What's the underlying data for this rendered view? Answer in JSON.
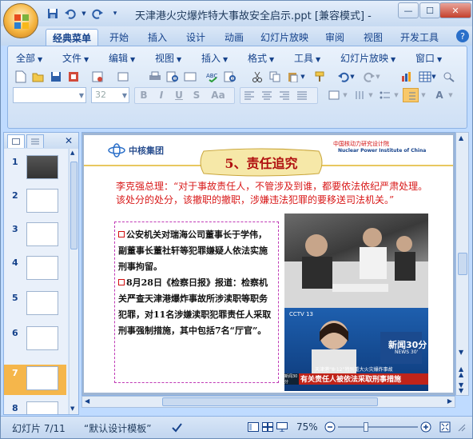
{
  "window": {
    "title": "天津港火灾爆炸特大事故安全启示.ppt [兼容模式] - M..."
  },
  "tabs": [
    "经典菜单",
    "开始",
    "插入",
    "设计",
    "动画",
    "幻灯片放映",
    "审阅",
    "视图",
    "开发工具"
  ],
  "menus": [
    "全部",
    "文件",
    "编辑",
    "视图",
    "插入",
    "格式",
    "工具",
    "幻灯片放映",
    "窗口"
  ],
  "font": {
    "name": "",
    "size": "32"
  },
  "slides_panel": {
    "numbers": [
      "1",
      "2",
      "3",
      "4",
      "5",
      "6",
      "7",
      "8"
    ],
    "selected": "7"
  },
  "slide": {
    "company": "中核集团",
    "title": "5、责任追究",
    "institute_cn": "中国核动力研究设计院",
    "institute_en": "Nuclear Power Institute of China",
    "quote": "李克强总理：“对于事故责任人，不管涉及到谁，都要依法依纪严肃处理。该处分的处分，该撤职的撤职，涉嫌违法犯罪的要移送司法机关。”",
    "bullet1": "公安机关对瑞海公司董事长于学伟，副董事长董社轩等犯罪嫌疑人依法实施刑事拘留。",
    "bullet2_a": "8月28日",
    "bullet2_b": "《检察日报》报道：检察机关严查天津港爆炸事故所涉渎职等职务犯罪，对",
    "bullet2_c": "11",
    "bullet2_d": "名涉嫌渎职犯罪责任人采取刑事强制措施，其中包括",
    "bullet2_e": "7",
    "bullet2_f": "名“厅官”。",
    "tv_channel": "CCTV 13",
    "tv_logo": "新闻30分",
    "tv_logo_en": "NEWS 30'",
    "tv_caption_small": "天津港“8·12”特别重大火灾爆炸事故",
    "tv_caption": "有关责任人被依法采取刑事措施",
    "tv_ticker": "新闻30分"
  },
  "status": {
    "slide": "幻灯片 7/11",
    "theme": "“默认设计模板”",
    "zoom": "75%"
  }
}
